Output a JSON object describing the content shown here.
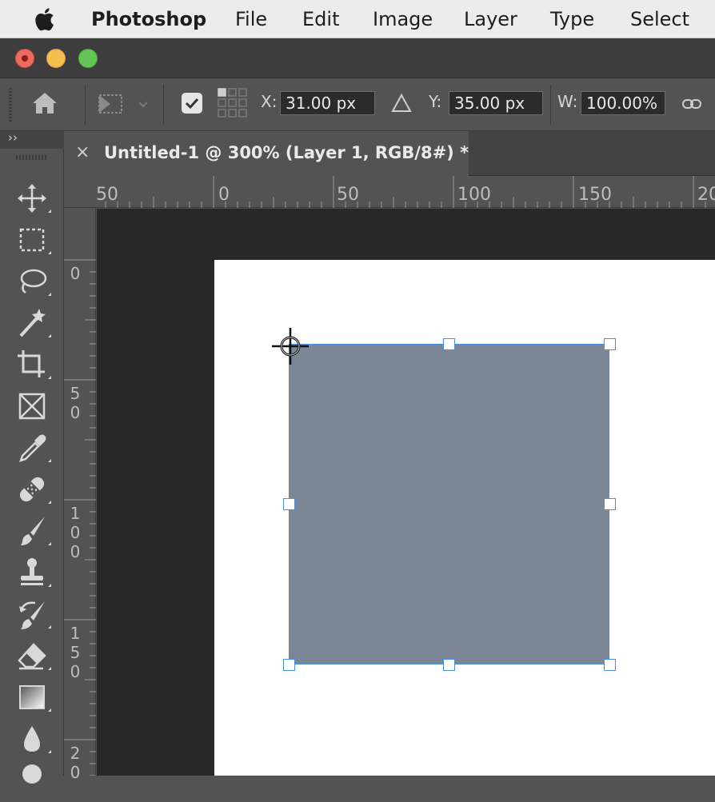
{
  "menubar": {
    "app_name": "Photoshop",
    "items": [
      "File",
      "Edit",
      "Image",
      "Layer",
      "Type",
      "Select"
    ],
    "apple_icon": "apple-icon"
  },
  "options_bar": {
    "x_label": "X:",
    "x_value": "31.00 px",
    "delta_icon": "triangle-icon",
    "y_label": "Y:",
    "y_value": "35.00 px",
    "w_label": "W:",
    "w_value": "100.00%",
    "link_icon": "chain-link-icon",
    "checkbox_checked": true
  },
  "toolbar": {
    "collapse_glyph": "››",
    "tools": [
      "move-tool",
      "marquee-tool",
      "lasso-tool",
      "magic-wand-tool",
      "crop-tool",
      "frame-tool",
      "eyedropper-tool",
      "healing-brush-tool",
      "brush-tool",
      "clone-stamp-tool",
      "history-brush-tool",
      "eraser-tool",
      "gradient-tool",
      "blur-tool",
      "dodge-tool"
    ]
  },
  "document": {
    "close_glyph": "×",
    "tab_title": "Untitled-1 @ 300% (Layer 1, RGB/8#) *"
  },
  "rulers": {
    "horizontal": [
      "50",
      "0",
      "50",
      "100",
      "150",
      "20"
    ],
    "vertical": [
      [
        "0"
      ],
      [
        "5",
        "0"
      ],
      [
        "1",
        "0",
        "0"
      ],
      [
        "1",
        "5",
        "0"
      ],
      [
        "2",
        "0"
      ]
    ]
  },
  "colors": {
    "shape_fill": "#7b8797",
    "selection": "#4a90e2",
    "pasteboard": "#282828",
    "ui_panel": "#535353"
  }
}
